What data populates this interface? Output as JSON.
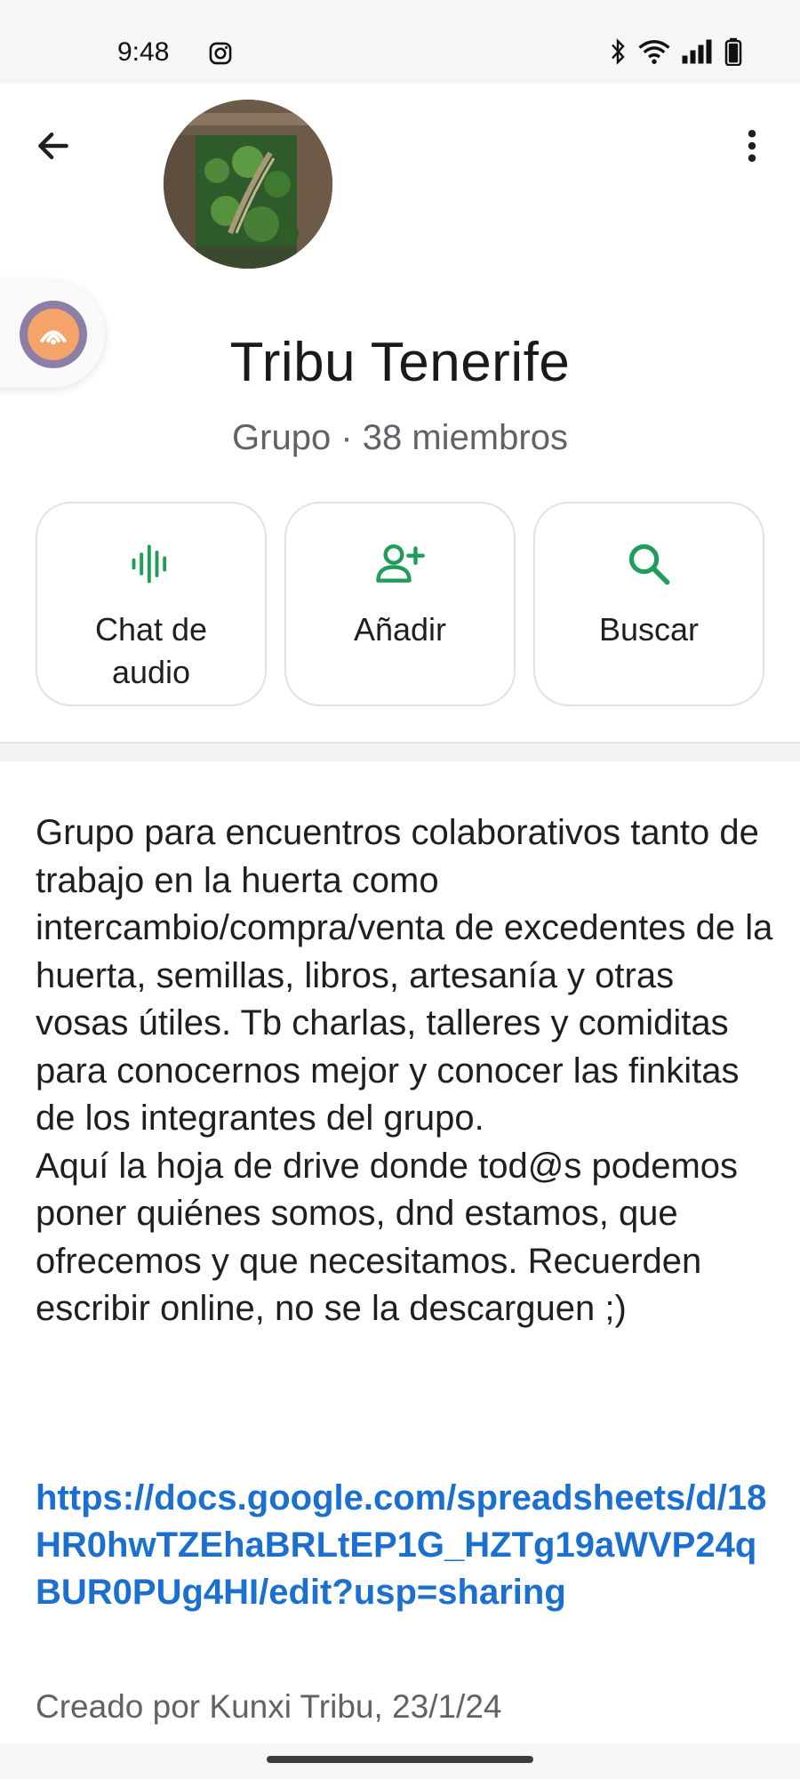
{
  "status_bar": {
    "time": "9:48",
    "icons": [
      "instagram-icon",
      "bluetooth-icon",
      "wifi-icon",
      "signal-icon",
      "battery-icon"
    ]
  },
  "header": {
    "title": "Tribu Tenerife",
    "subtitle": "Grupo · 38 miembros",
    "icons": [
      "back-arrow-icon",
      "more-vert-icon"
    ]
  },
  "actions": [
    {
      "label": "Chat de audio",
      "icon": "audio-waveform-icon"
    },
    {
      "label": "Añadir",
      "icon": "add-person-icon"
    },
    {
      "label": "Buscar",
      "icon": "search-icon"
    }
  ],
  "description": "Grupo para encuentros colaborativos tanto de trabajo en la huerta como intercambio/compra/venta de excedentes de la huerta, semillas, libros, artesanía y otras vosas útiles. Tb charlas, talleres y comiditas para conocernos mejor y conocer las finkitas de los integrantes del grupo.\nAquí la hoja de drive donde tod@s podemos poner quiénes somos, dnd estamos, que ofrecemos y que necesitamos. Recuerden escribir online, no se la descarguen ;)",
  "link": "https://docs.google.com/spreadsheets/d/18HR0hwTZEhaBRLtEP1G_HZTg19aWVP24qBUR0PUg4HI/edit?usp=sharing",
  "created_by": "Creado por Kunxi Tribu, 23/1/24",
  "colors": {
    "accent_green": "#1e9e5a",
    "link_blue": "#1a6fcf"
  }
}
